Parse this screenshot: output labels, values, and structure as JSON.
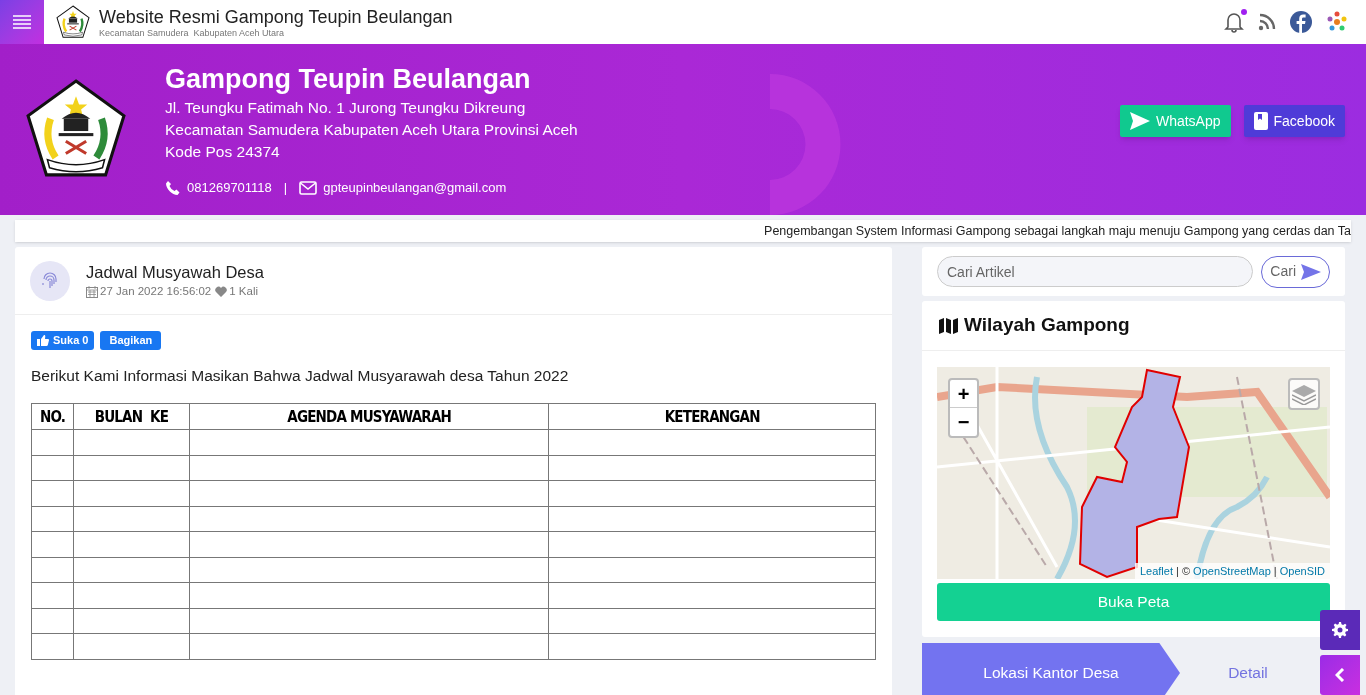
{
  "topbar": {
    "title": "Website Resmi Gampong Teupin Beulangan",
    "subtitle": "Kecamatan Samudera  Kabupaten Aceh Utara"
  },
  "hero": {
    "name": "Gampong Teupin Beulangan",
    "address_lines": [
      "Jl. Teungku Fatimah No. 1 Jurong Teungku Dikreung",
      "Kecamatan Samudera Kabupaten Aceh Utara Provinsi Aceh",
      "Kode Pos 24374"
    ],
    "phone": "081269701118",
    "separator": "|",
    "email": "gpteupinbeulangan@gmail.com",
    "buttons": [
      {
        "kind": "whatsapp",
        "label": "WhatsApp"
      },
      {
        "kind": "facebook",
        "label": "Facebook"
      }
    ]
  },
  "ticker": "Pengembangan System Informasi Gampong sebagai langkah maju menuju Gampong yang cerdas dan Ta",
  "article": {
    "title": "Jadwal Musyawah Desa",
    "date": "27 Jan 2022 16:56:02",
    "views": "1 Kali",
    "like_button": "Suka 0",
    "share_button": "Bagikan",
    "intro": "Berikut Kami Informasi Masikan Bahwa Jadwal Musyarawah desa Tahun 2022",
    "table": {
      "columns": [
        "NO.",
        "BULAN  KE",
        "AGENDA MUSYAWARAH",
        "KETERANGAN"
      ]
    }
  },
  "search": {
    "placeholder": "Cari Artikel",
    "button": "Cari"
  },
  "map_widget": {
    "title": "Wilayah Gampong",
    "zoom_in": "+",
    "zoom_out": "−",
    "attribution": [
      {
        "kind": "link",
        "text": "Leaflet"
      },
      {
        "kind": "text",
        "text": " | © "
      },
      {
        "kind": "link",
        "text": "OpenStreetMap"
      },
      {
        "kind": "text",
        "text": " | "
      },
      {
        "kind": "link",
        "text": "OpenSID"
      }
    ],
    "button": "Buka Peta"
  },
  "office_tabs": [
    {
      "label": "Lokasi Kantor Desa",
      "selected": true
    },
    {
      "label": "Detail",
      "selected": false
    }
  ]
}
